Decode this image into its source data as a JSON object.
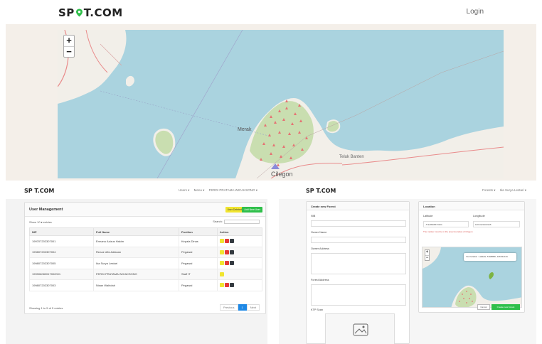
{
  "brand": "SP T.COM",
  "header": {
    "login_label": "Login"
  },
  "hero_map": {
    "labels": {
      "merak": "Merak",
      "cilegon": "Cilegon",
      "teluk": "Teluk Banten"
    },
    "colors": {
      "sea": "#aad3df",
      "land": "#f2efe9",
      "forest": "#c9deb0",
      "marker": "#e57373",
      "road": "#e98b8b"
    }
  },
  "left_panel": {
    "nav": {
      "users": "Users ▾",
      "menu": "Menu ▾",
      "user": "FERDI PRATAMA WICAKSONO ▾"
    },
    "card_title": "User Management",
    "btn_user_deleted": "User Deleted",
    "btn_add_user": "Add New User",
    "show_entries": "Show 10 ▾ entries",
    "search_label": "Search:",
    "columns": [
      "NIP",
      "Full Name",
      "Position",
      "Action"
    ],
    "rows": [
      {
        "nip": "199707202307001",
        "name": "Ermanu Azizus Hakim",
        "position": "Kepala Dinas",
        "actions": 3
      },
      {
        "nip": "199807202307004",
        "name": "Rezza Ulfa Adlanan",
        "position": "Pegawai",
        "actions": 3
      },
      {
        "nip": "199807202307005",
        "name": "Ika Surya Lestari",
        "position": "Pegawai",
        "actions": 3
      },
      {
        "nip": "199906082017002001",
        "name": "FERDI PRATAMA WICAKSONO",
        "position": "Staff IT",
        "actions": 1
      },
      {
        "nip": "199807202307003",
        "name": "Nisan Wahidah",
        "position": "Pegawai",
        "actions": 3
      }
    ],
    "footer": "Showing 1 to 5 of 5 entries",
    "pager": {
      "prev": "Previous",
      "page": "1",
      "next": "Next"
    }
  },
  "right_panel": {
    "nav": {
      "forests": "Forests ▾",
      "user": "Ika Surya Lestari ▾"
    },
    "create_title": "Create new Forest",
    "fields": {
      "nib": "NIB",
      "owner_name": "Owner Name",
      "owner_address": "Owner Address",
      "forest_address": "Forest Address",
      "ktp": "KTP Scan"
    },
    "location_title": "Location",
    "latitude_label": "Latitude",
    "longitude_label": "Longitude",
    "latitude_value": "-5.929999574334",
    "longitude_value": "106.0121203145",
    "location_note": "The marker must be in the area boundary of Cilegon",
    "popup": "Your location : Latitude -5.929999 , 106.012121",
    "cancel": "Cancel",
    "create": "Create new Forest"
  }
}
